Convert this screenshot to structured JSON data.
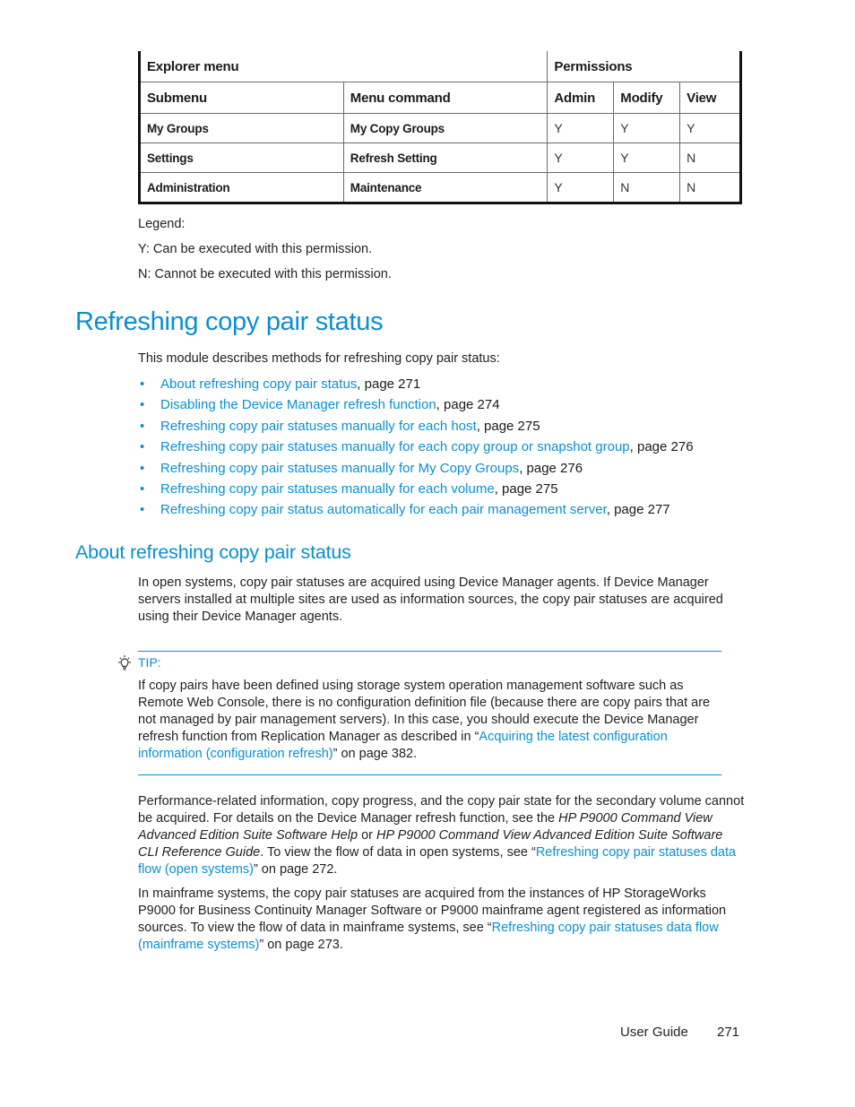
{
  "table": {
    "header1": {
      "explorer_menu": "Explorer menu",
      "permissions": "Permissions"
    },
    "header2": [
      "Submenu",
      "Menu command",
      "Admin",
      "Modify",
      "View"
    ],
    "rows": [
      {
        "submenu": "My Groups",
        "command": "My Copy Groups",
        "admin": "Y",
        "modify": "Y",
        "view": "Y"
      },
      {
        "submenu": "Settings",
        "command": "Refresh Setting",
        "admin": "Y",
        "modify": "Y",
        "view": "N"
      },
      {
        "submenu": "Administration",
        "command": "Maintenance",
        "admin": "Y",
        "modify": "N",
        "view": "N"
      }
    ]
  },
  "legend": {
    "title": "Legend:",
    "y": "Y: Can be executed with this permission.",
    "n": "N: Cannot be executed with this permission."
  },
  "section": {
    "title": "Refreshing copy pair status",
    "intro": "This module describes methods for refreshing copy pair status:",
    "bullet": "•",
    "toc": [
      {
        "link": "About refreshing copy pair status",
        "suffix": ", page 271"
      },
      {
        "link": "Disabling the Device Manager refresh function",
        "suffix": ", page 274"
      },
      {
        "link": "Refreshing copy pair statuses manually for each host",
        "suffix": ", page 275"
      },
      {
        "link": "Refreshing copy pair statuses manually for each copy group or snapshot group",
        "suffix": ", page 276"
      },
      {
        "link": "Refreshing copy pair statuses manually for My Copy Groups",
        "suffix": ", page 276"
      },
      {
        "link": "Refreshing copy pair statuses manually for each volume",
        "suffix": ", page 275"
      },
      {
        "link": "Refreshing copy pair status automatically for each pair management server",
        "suffix": ", page 277"
      }
    ]
  },
  "subsection": {
    "title": "About refreshing copy pair status",
    "p1": "In open systems, copy pair statuses are acquired using Device Manager agents. If Device Manager servers installed at multiple sites are used as information sources, the copy pair statuses are acquired using their Device Manager agents.",
    "tip": {
      "label": "TIP:",
      "text_before": "If copy pairs have been defined using storage system operation management software such as Remote Web Console, there is no configuration definition file (because there are copy pairs that are not managed by pair management servers). In this case, you should execute the Device Manager refresh function from Replication Manager as described in “",
      "link": "Acquiring the latest configuration information (configuration refresh)",
      "text_after": "” on page 382."
    },
    "p2": {
      "a": "Performance-related information, copy progress, and the copy pair state for the secondary volume cannot be acquired. For details on the Device Manager refresh function, see the ",
      "i1": "HP P9000 Command View Advanced Edition Suite Software Help",
      "b": " or ",
      "i2": "HP P9000 Command View Advanced Edition Suite Software CLI Reference Guide",
      "c": ".  To view the flow of data in open systems, see “",
      "link": "Refreshing copy pair statuses data flow (open systems)",
      "d": "” on page 272."
    },
    "p3": {
      "a": "In mainframe systems, the copy pair statuses are acquired from the instances of HP StorageWorks P9000 for Business Continuity Manager Software or P9000 mainframe agent registered as information sources. To view the flow of data in mainframe systems, see “",
      "link": "Refreshing copy pair statuses data flow (mainframe systems)",
      "b": "” on page 273."
    }
  },
  "footer": {
    "label": "User Guide",
    "page": "271"
  }
}
